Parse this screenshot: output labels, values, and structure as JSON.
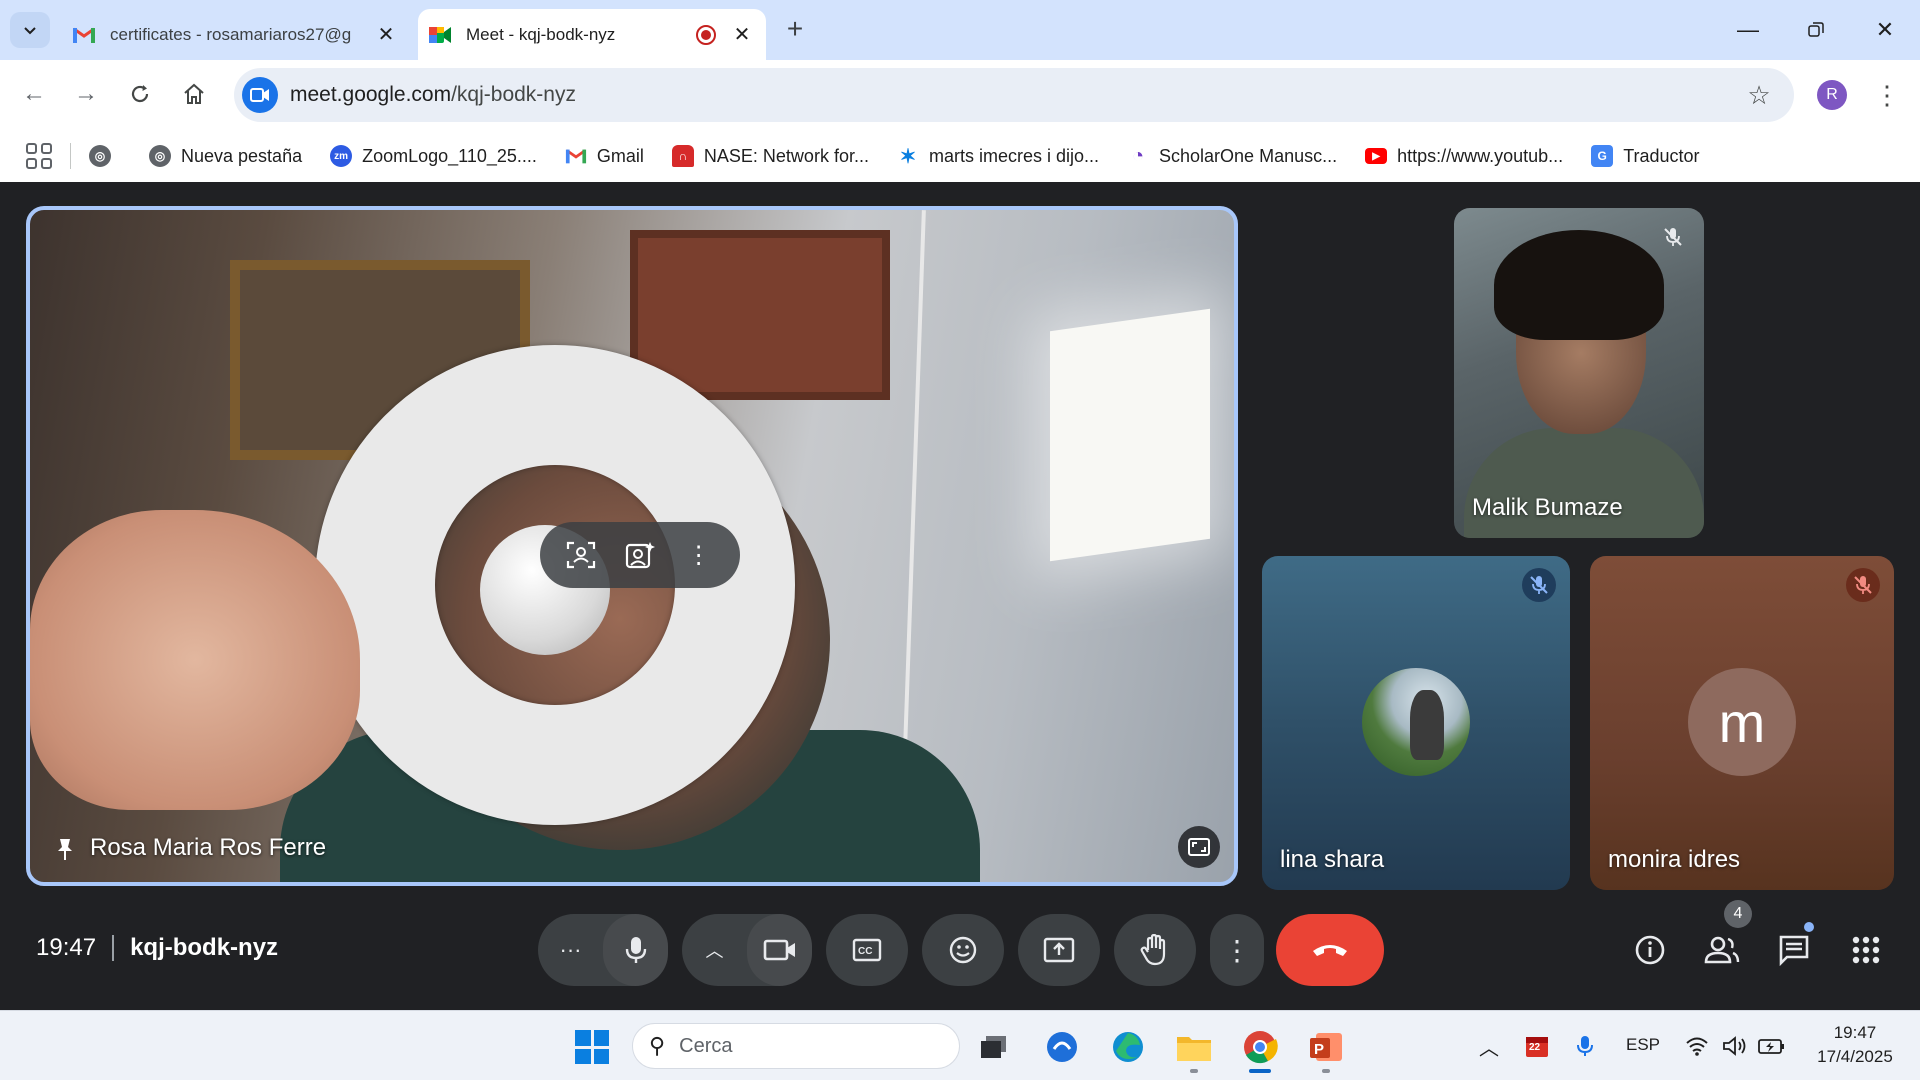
{
  "browser": {
    "tabs": [
      {
        "title": "certificates - rosamariaros27@g",
        "active": false,
        "favicon": "gmail-icon"
      },
      {
        "title": "Meet - kqj-bodk-nyz",
        "active": true,
        "favicon": "meet-icon",
        "recording": true
      }
    ],
    "url_domain": "meet.google.com",
    "url_path": "/kqj-bodk-nyz",
    "profile_initial": "R",
    "bookmarks": [
      {
        "label": "",
        "icon": "globe-icon"
      },
      {
        "label": "Nueva pestaña",
        "icon": "globe-icon"
      },
      {
        "label": "ZoomLogo_110_25....",
        "icon": "zoom-icon"
      },
      {
        "label": "Gmail",
        "icon": "gmail-icon"
      },
      {
        "label": "NASE: Network for...",
        "icon": "nase-icon"
      },
      {
        "label": "marts imecres i dijo...",
        "icon": "caixabank-icon"
      },
      {
        "label": "ScholarOne Manusc...",
        "icon": "scholarone-icon"
      },
      {
        "label": "https://www.youtub...",
        "icon": "youtube-icon"
      },
      {
        "label": "Traductor",
        "icon": "translate-icon"
      }
    ]
  },
  "meet": {
    "main_participant": {
      "name": "Rosa Maria Ros Ferre",
      "pinned": true
    },
    "participants": [
      {
        "name": "Malik Bumaze",
        "muted": true
      },
      {
        "name": "lina shara",
        "muted": true,
        "avatar": "photo"
      },
      {
        "name": "monira idres",
        "muted": true,
        "avatar_letter": "m"
      }
    ],
    "time": "19:47",
    "meeting_code": "kqj-bodk-nyz",
    "people_count": "4",
    "colors": {
      "hangup": "#ea4335",
      "background": "#202124",
      "highlight": "#a8c7fa"
    }
  },
  "taskbar": {
    "search_placeholder": "Cerca",
    "language": "ESP",
    "time": "19:47",
    "date": "17/4/2025",
    "calendar_badge": "22"
  }
}
